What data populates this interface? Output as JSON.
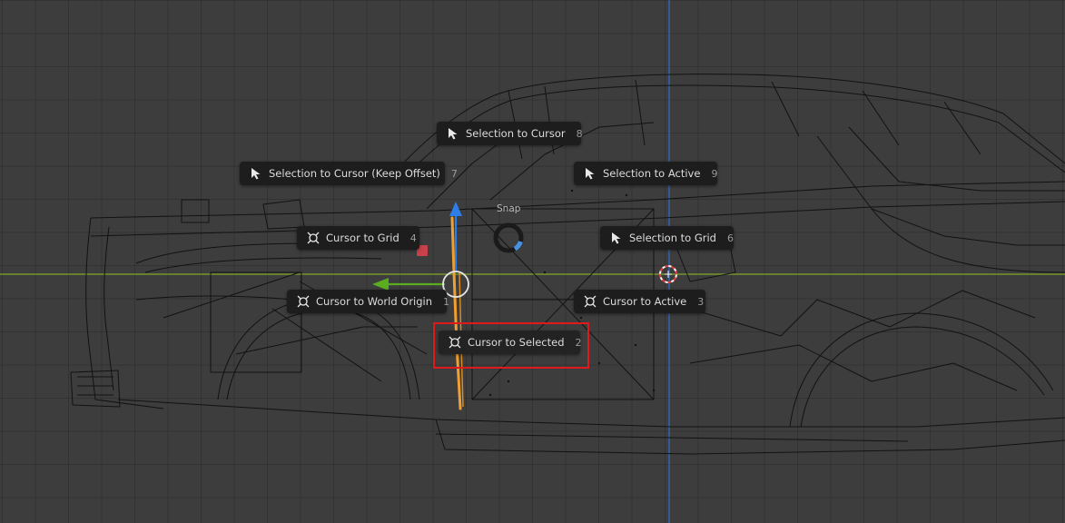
{
  "pie_menu": {
    "title": "Snap",
    "items": [
      {
        "id": "selection-to-cursor",
        "label": "Selection to Cursor",
        "key": "8",
        "icon": "cursor-arrow-icon"
      },
      {
        "id": "selection-to-cursor-keep-offset",
        "label": "Selection to Cursor (Keep Offset)",
        "key": "7",
        "icon": "cursor-arrow-icon"
      },
      {
        "id": "selection-to-active",
        "label": "Selection to Active",
        "key": "9",
        "icon": "cursor-arrow-icon"
      },
      {
        "id": "cursor-to-grid",
        "label": "Cursor to Grid",
        "key": "4",
        "icon": "3d-cursor-icon"
      },
      {
        "id": "selection-to-grid",
        "label": "Selection to Grid",
        "key": "6",
        "icon": "cursor-arrow-icon"
      },
      {
        "id": "cursor-to-world-origin",
        "label": "Cursor to World Origin",
        "key": "1",
        "icon": "3d-cursor-icon"
      },
      {
        "id": "cursor-to-active",
        "label": "Cursor to Active",
        "key": "3",
        "icon": "3d-cursor-icon"
      },
      {
        "id": "cursor-to-selected",
        "label": "Cursor to Selected",
        "key": "2",
        "icon": "3d-cursor-icon"
      }
    ],
    "highlighted": "Cursor to Selected"
  },
  "colors": {
    "background": "#3d3d3d",
    "x_axis": "#7fa82a",
    "z_axis": "#2e6fd0",
    "gizmo_y": "#5aad1f",
    "gizmo_z": "#2f7ee8",
    "selected_edge": "#f0a030",
    "highlight_box": "#e01a1a",
    "pie_direction": "#4a90e2"
  },
  "icons": {
    "cursor_arrow": "cursor-arrow-icon",
    "cursor_3d": "3d-cursor-icon"
  }
}
